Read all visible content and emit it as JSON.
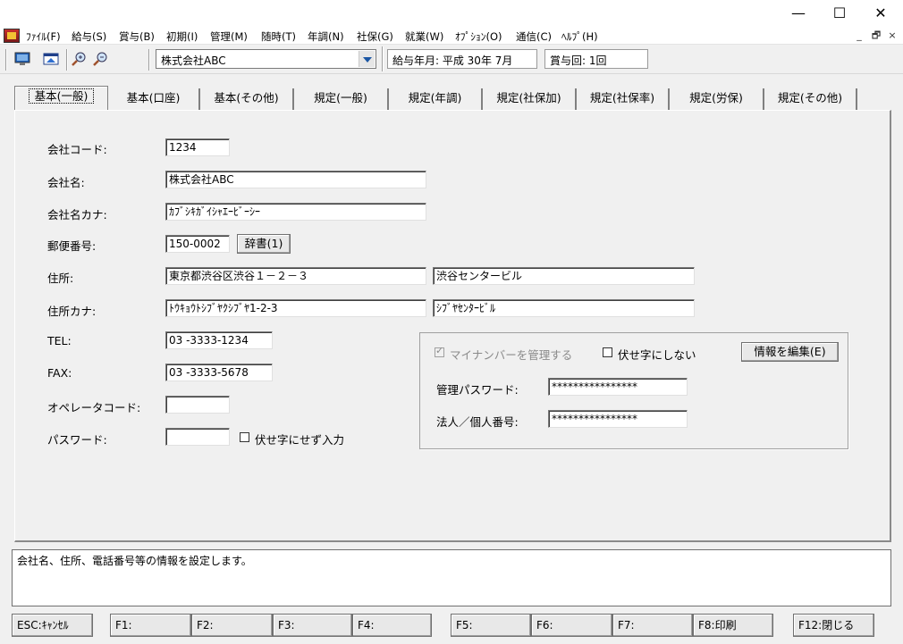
{
  "window": {
    "minimize": "—",
    "maximize": "☐",
    "close": "✕"
  },
  "menu": [
    "ﾌｧｲﾙ(F)",
    "給与(S)",
    "賞与(B)",
    "初期(I)",
    "管理(M)",
    "随時(T)",
    "年調(N)",
    "社保(G)",
    "就業(W)",
    "ｵﾌﾟｼｮﾝ(O)",
    "通信(C)",
    "ﾍﾙﾌﾟ(H)"
  ],
  "mdi": {
    "minimize": "_",
    "restore": "🗗",
    "close": "×"
  },
  "toolbar": {
    "company_select": "株式会社ABC",
    "pay_period": "給与年月: 平成 30年  7月",
    "bonus_round": "賞与回: 1回"
  },
  "tabs": [
    "基本(一般)",
    "基本(口座)",
    "基本(その他)",
    "規定(一般)",
    "規定(年調)",
    "規定(社保加)",
    "規定(社保率)",
    "規定(労保)",
    "規定(その他)"
  ],
  "form": {
    "company_code_label": "会社コード:",
    "company_code": "1234",
    "company_name_label": "会社名:",
    "company_name": "株式会社ABC",
    "company_kana_label": "会社名カナ:",
    "company_kana": "ｶﾌﾞｼｷｶﾞｲｼｬｴｰﾋﾞｰｼｰ",
    "postal_label": "郵便番号:",
    "postal": "150-0002",
    "dict_button": "辞書(1)",
    "address_label": "住所:",
    "address1": "東京都渋谷区渋谷１－２－３",
    "address2": "渋谷センタービル",
    "address_kana_label": "住所カナ:",
    "address_kana1": "ﾄｳｷｮｳﾄｼﾌﾞﾔｸｼﾌﾞﾔ1-2-3",
    "address_kana2": "ｼﾌﾞﾔｾﾝﾀｰﾋﾞﾙ",
    "tel_label": "TEL:",
    "tel": "03  -3333-1234",
    "fax_label": "FAX:",
    "fax": "03  -3333-5678",
    "operator_label": "オペレータコード:",
    "operator": "",
    "password_label": "パスワード:",
    "password": "",
    "no_mask_label": "伏せ字にせず入力"
  },
  "mynumber": {
    "manage_label": "マイナンバーを管理する",
    "no_mask_label": "伏せ字にしない",
    "edit_button": "情報を編集(E)",
    "admin_pw_label": "管理パスワード:",
    "admin_pw": "****************",
    "corp_no_label": "法人／個人番号:",
    "corp_no": "****************"
  },
  "status_text": "会社名、住所、電話番号等の情報を設定します。",
  "fkeys": [
    "ESC:ｷｬﾝｾﾙ",
    "F1:",
    "F2:",
    "F3:",
    "F4:",
    "F5:",
    "F6:",
    "F7:",
    "F8:印刷",
    "F12:閉じる"
  ]
}
